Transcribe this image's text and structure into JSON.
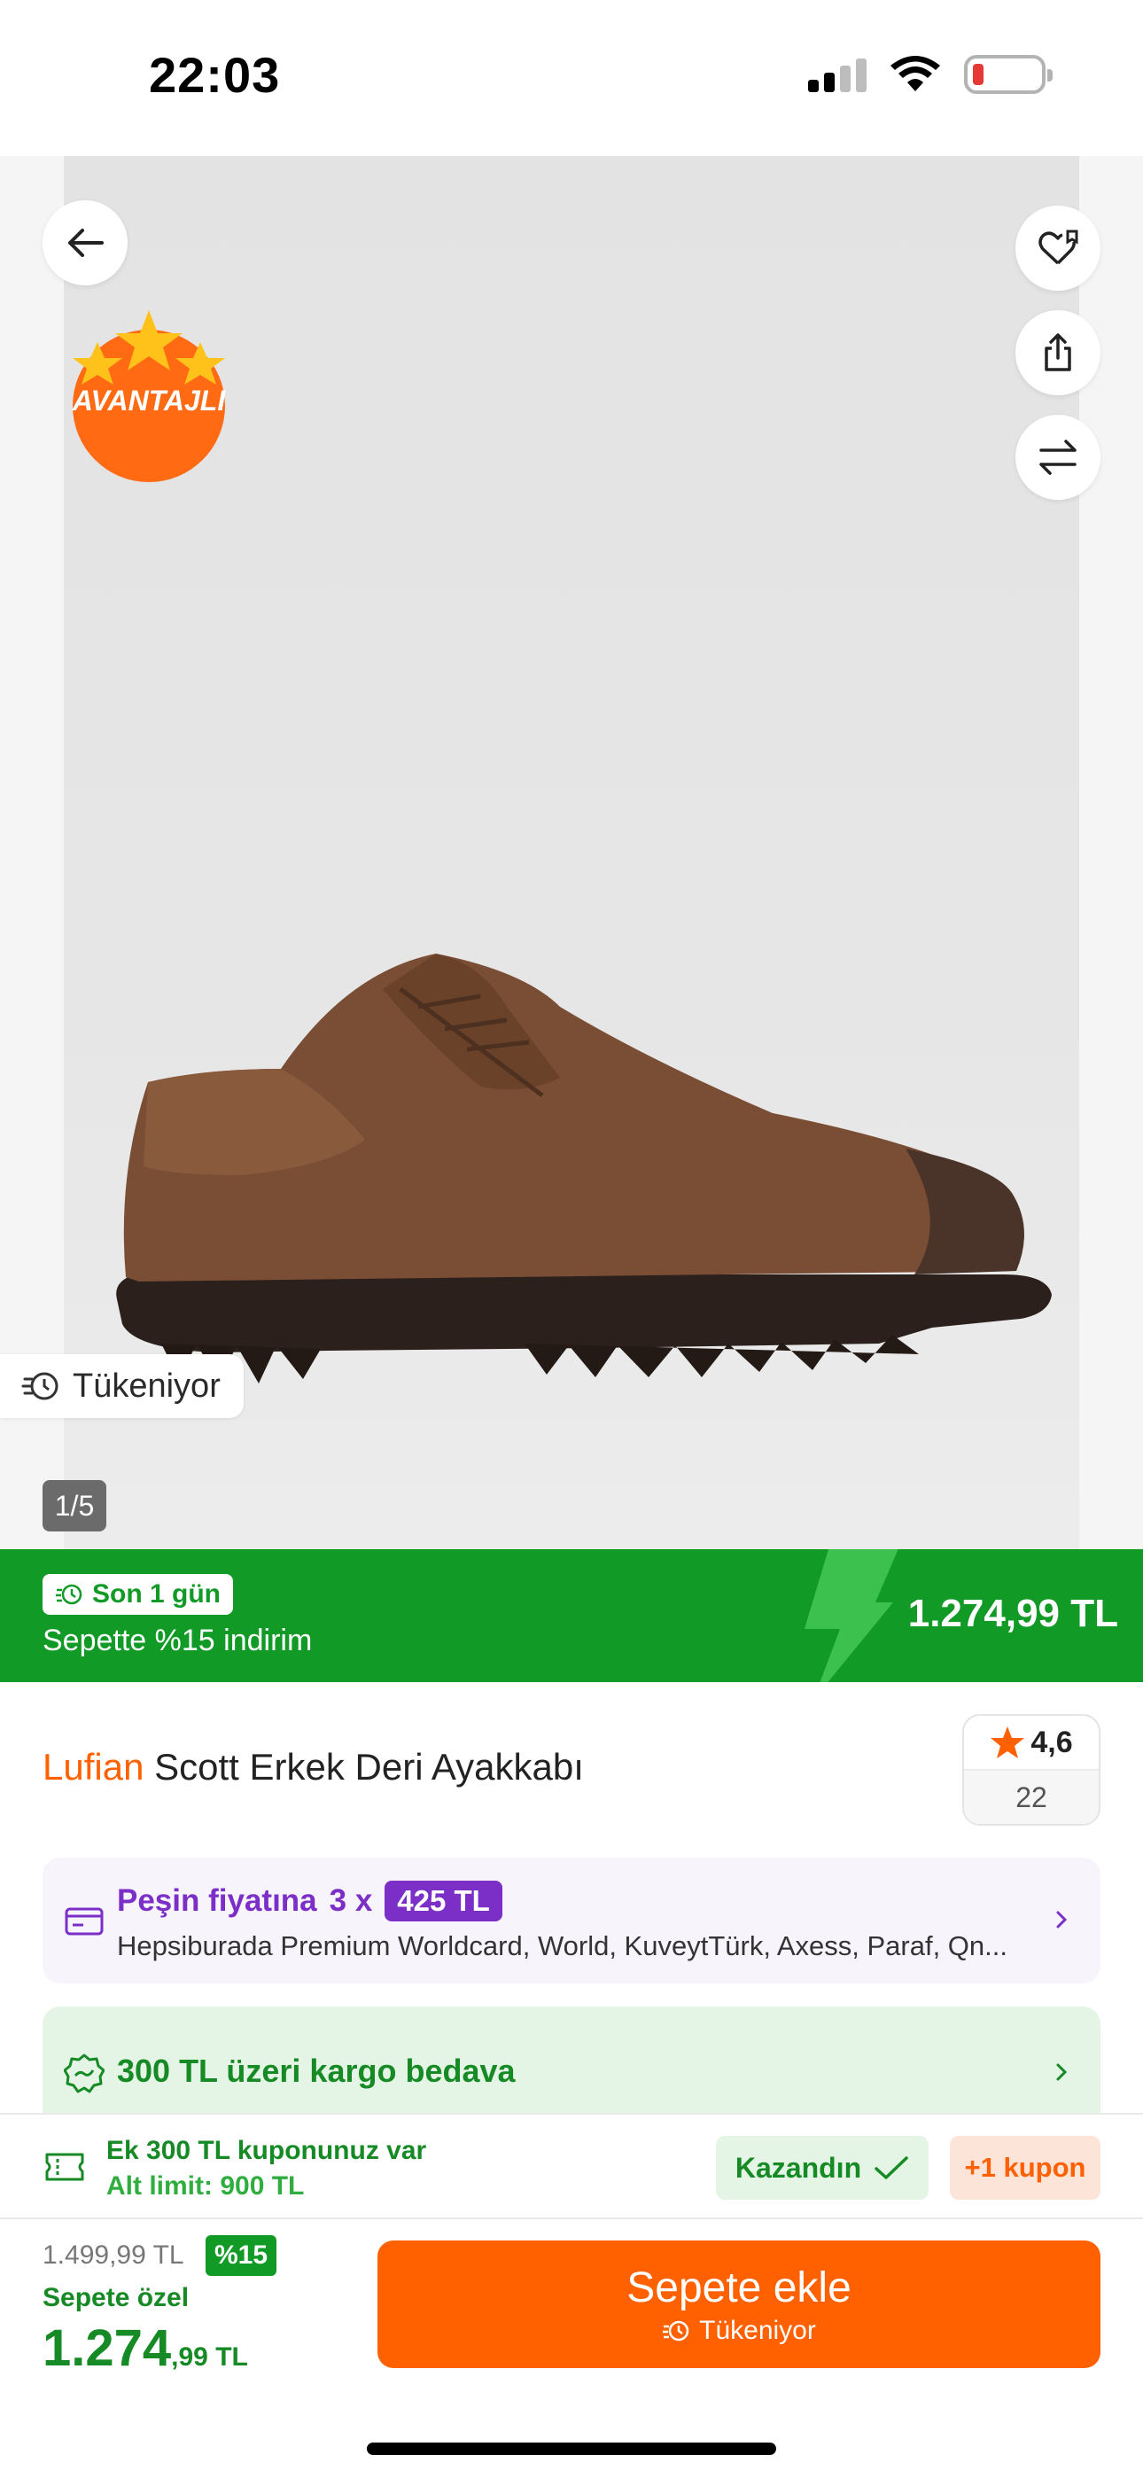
{
  "status_bar": {
    "time": "22:03",
    "battery_level_pct": 10
  },
  "gallery": {
    "badge_label": "AVANTAJLI",
    "stock_label": "Tükeniyor",
    "page_indicator": "1/5",
    "icons": [
      "back-arrow-icon",
      "heart-list-icon",
      "share-icon",
      "compare-icon"
    ]
  },
  "promo": {
    "chip_label": "Son 1 gün",
    "subtitle": "Sepette %15 indirim",
    "price": "1.274,99 TL",
    "colors": {
      "band": "#119a26",
      "bolt": "#3cc14e"
    }
  },
  "product": {
    "brand": "Lufian",
    "name": "Scott Erkek Deri Ayakkabı",
    "rating": "4,6",
    "review_count": "22"
  },
  "installment": {
    "prefix": "Peşin fiyatına",
    "multiplier": "3 x",
    "amount": "425 TL",
    "banks": "Hepsiburada Premium Worldcard, World, KuveytTürk, Axess, Paraf, Qn..."
  },
  "shipping": {
    "label": "300 TL üzeri kargo bedava"
  },
  "coupon": {
    "line1": "Ek 300 TL kuponunuz var",
    "line2": "Alt limit: 900 TL",
    "won_label": "Kazandın",
    "more_label": "+1 kupon"
  },
  "purchase": {
    "old_price": "1.499,99 TL",
    "discount": "%15",
    "special_label": "Sepete özel",
    "price_main": "1.274",
    "price_dec": ",99 TL",
    "cta_label": "Sepete ekle",
    "cta_sub": "Tükeniyor"
  },
  "colors": {
    "accent": "#ff6000",
    "green": "#119a26",
    "purple": "#7b2fc7"
  }
}
